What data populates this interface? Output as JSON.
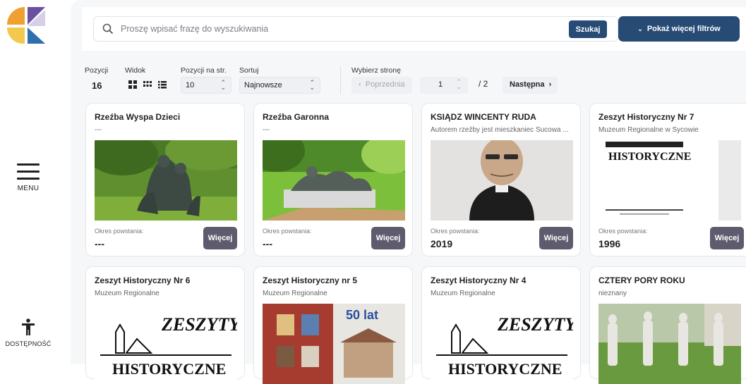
{
  "search": {
    "placeholder": "Proszę wpisać frazę do wyszukiwania",
    "button_label": "Szukaj",
    "filters_label": "Pokaż więcej filtrów"
  },
  "sidebar": {
    "menu_label": "MENU",
    "accessibility_label": "DOSTĘPNOŚĆ"
  },
  "toolbar": {
    "positions_label": "Pozycji",
    "positions_value": "16",
    "view_label": "Widok",
    "per_page_label": "Pozycji na str.",
    "per_page_value": "10",
    "sort_label": "Sortuj",
    "sort_value": "Najnowsze",
    "choose_page_label": "Wybierz stronę",
    "prev_label": "Poprzednia",
    "page_value": "1",
    "page_total": "/ 2",
    "next_label": "Następna"
  },
  "cards": [
    {
      "title": "Rzeźba Wyspa Dzieci",
      "subtitle": "---",
      "period_label": "Okres powstania:",
      "period_value": "---",
      "more_label": "Więcej"
    },
    {
      "title": "Rzeźba Garonna",
      "subtitle": "---",
      "period_label": "Okres powstania:",
      "period_value": "---",
      "more_label": "Więcej"
    },
    {
      "title": "KSIĄDZ WINCENTY RUDA",
      "subtitle": "Autorem rzeźby jest mieszkaniec Sucowa ...",
      "period_label": "Okres powstania:",
      "period_value": "2019",
      "more_label": "Więcej"
    },
    {
      "title": "Zeszyt Historyczny Nr 7",
      "subtitle": "Muzeum Regionalne w Sycowie",
      "period_label": "Okres powstania:",
      "period_value": "1996",
      "more_label": "Więcej"
    },
    {
      "title": "Zeszyt Historyczny Nr 6",
      "subtitle": "Muzeum Regionalne"
    },
    {
      "title": "Zeszyt Historyczny nr 5",
      "subtitle": "Muzeum Regionalne"
    },
    {
      "title": "Zeszyt Historyczny Nr 4",
      "subtitle": "Muzeum Regionalne"
    },
    {
      "title": "CZTERY PORY ROKU",
      "subtitle": "nieznany"
    }
  ],
  "images": {
    "zeszyty_top_text": "ZESZYTY",
    "zeszyty_bottom_text": "HISTORYCZNE",
    "zeszyt5_number": "50 lat"
  },
  "colors": {
    "primary": "#274b75",
    "more_button": "#5e5b6e",
    "logo_orange": "#f0a030",
    "logo_purple": "#6b4fa0",
    "logo_yellow": "#f2c94c",
    "logo_blue": "#2f6fb0"
  }
}
